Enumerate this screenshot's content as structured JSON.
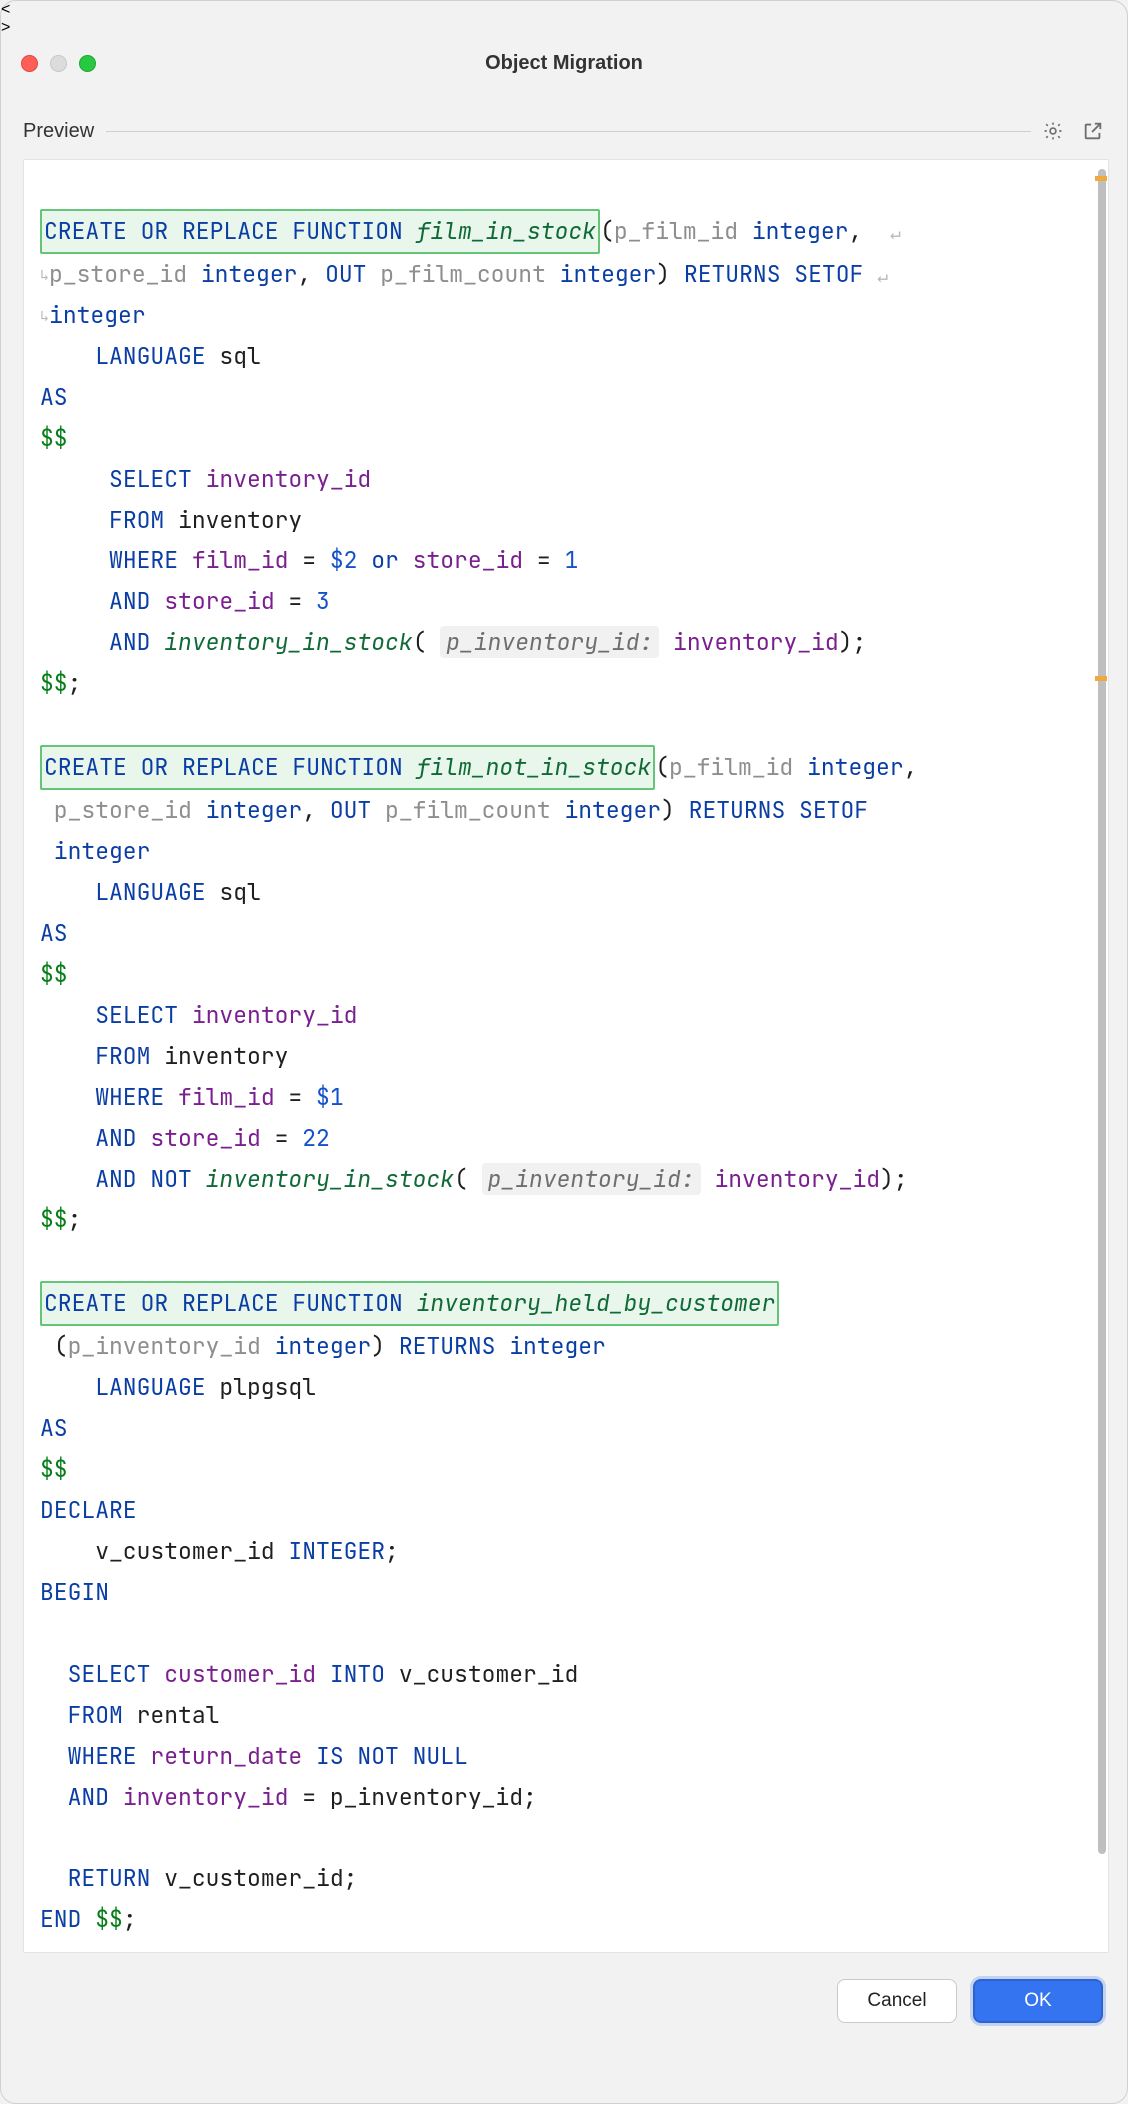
{
  "window": {
    "title": "Object Migration"
  },
  "section": {
    "label": "Preview"
  },
  "icons": {
    "settings": "gear-icon",
    "popout": "external-window-icon"
  },
  "footer": {
    "cancel_label": "Cancel",
    "ok_label": "OK"
  },
  "scrollbar": {
    "thumb_top_pct": 0.5,
    "thumb_height_pct": 94,
    "markers_pct": [
      0.9,
      28.8
    ]
  },
  "code": {
    "fn1": {
      "decl": "CREATE OR REPLACE FUNCTION ",
      "name": "film_in_stock",
      "sig1_open": "(",
      "sig1a": "p_film_id ",
      "sig1a_ty": "integer",
      "sig1_tr": ", ",
      "sig2a": "p_store_id ",
      "sig2a_ty": "integer",
      "sig2_c": ", ",
      "sig2b_kw": "OUT",
      "sig2b": " p_film_count ",
      "sig2b_ty": "integer",
      "sig2_cl": ") ",
      "ret_kw": "RETURNS SETOF ",
      "ret_ty": "integer",
      "lang_kw": "LANGUAGE",
      "lang": " sql",
      "as": "AS",
      "dd_open": "$$",
      "sel_kw": "SELECT",
      "sel_col": " inventory_id",
      "from_kw": "FROM",
      "from_tbl": " inventory",
      "where_kw": "WHERE",
      "where_col": " film_id",
      "where_eq": " = ",
      "where_p": "$2",
      "where_or": " or ",
      "where_col2": "store_id",
      "where_eq2": " = ",
      "where_v2": "1",
      "and_kw": "AND",
      "and_col": " store_id",
      "and_eq": " = ",
      "and_v": "3",
      "and2_kw": "AND",
      "and2_fn": " inventory_in_stock",
      "and2_open": "( ",
      "and2_hint": "p_inventory_id:",
      "and2_arg": " inventory_id",
      "and2_close": ");",
      "dd_close": "$$",
      "semi": ";"
    },
    "fn2": {
      "decl": "CREATE OR REPLACE FUNCTION ",
      "name": "film_not_in_stock",
      "sig1_open": "(",
      "sig1a": "p_film_id ",
      "sig1a_ty": "integer",
      "sig1_tr": ",",
      "sig2a": " p_store_id ",
      "sig2a_ty": "integer",
      "sig2_c": ", ",
      "sig2b_kw": "OUT",
      "sig2b": " p_film_count ",
      "sig2b_ty": "integer",
      "sig2_cl": ") ",
      "ret_kw": "RETURNS SETOF",
      "ret_ty": " integer",
      "lang_kw": "LANGUAGE",
      "lang": " sql",
      "as": "AS",
      "dd_open": "$$",
      "sel_kw": "SELECT",
      "sel_col": " inventory_id",
      "from_kw": "FROM",
      "from_tbl": " inventory",
      "where_kw": "WHERE",
      "where_col": " film_id",
      "where_eq": " = ",
      "where_p": "$1",
      "and_kw": "AND",
      "and_col": " store_id",
      "and_eq": " = ",
      "and_v": "22",
      "and2_kw": "AND NOT",
      "and2_fn": " inventory_in_stock",
      "and2_open": "( ",
      "and2_hint": "p_inventory_id:",
      "and2_arg": " inventory_id",
      "and2_close": ");",
      "dd_close": "$$",
      "semi": ";"
    },
    "fn3": {
      "decl": "CREATE OR REPLACE FUNCTION ",
      "name": "inventory_held_by_customer",
      "sig_open": " (",
      "siga": "p_inventory_id ",
      "siga_ty": "integer",
      "sig_cl": ") ",
      "ret_kw": "RETURNS",
      "ret_ty": " integer",
      "lang_kw": "LANGUAGE",
      "lang": " plpgsql",
      "as": "AS",
      "dd_open": "$$",
      "declare_kw": "DECLARE",
      "decl_var": "    v_customer_id ",
      "decl_ty": "INTEGER",
      "decl_semi": ";",
      "begin_kw": "BEGIN",
      "sel_kw": "SELECT",
      "sel_col": " customer_id",
      "into_kw": " INTO",
      "into_var": " v_customer_id",
      "from_kw": "FROM",
      "from_tbl": " rental",
      "where_kw": "WHERE",
      "where_col": " return_date",
      "where_nn": " IS NOT NULL",
      "and_kw": "AND",
      "and_col": " inventory_id",
      "and_eq": " = ",
      "and_var": "p_inventory_id;",
      "return_kw": "RETURN",
      "return_var": " v_customer_id;",
      "end_kw": "END",
      "dd_close": " $$",
      "semi": ";"
    }
  }
}
